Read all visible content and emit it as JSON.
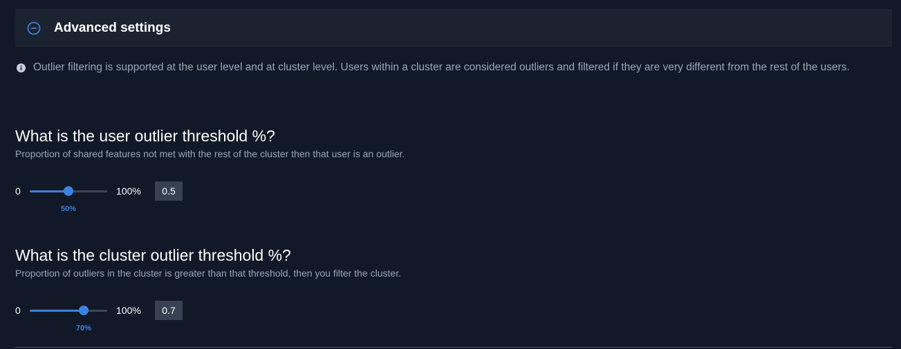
{
  "advanced_settings": {
    "title": "Advanced settings",
    "toggle_icon": "minus-circle-icon"
  },
  "info": {
    "icon": "info-icon",
    "text": "Outlier filtering is supported at the user level and at cluster level. Users within a cluster are considered outliers and filtered if they are very different from the rest of the users."
  },
  "user_threshold": {
    "title": "What is the user outlier threshold %?",
    "description": "Proportion of shared features not met with the rest of the cluster then that user is an outlier.",
    "min_label": "0",
    "max_label": "100%",
    "percent_label": "50%",
    "value": "0.5",
    "fraction": 0.5
  },
  "cluster_threshold": {
    "title": "What is the cluster outlier threshold %?",
    "description": "Proportion of outliers in the cluster is greater than that threshold, then you filter the cluster.",
    "min_label": "0",
    "max_label": "100%",
    "percent_label": "70%",
    "value": "0.7",
    "fraction": 0.7
  },
  "colors": {
    "background": "#111827",
    "header_background": "#1b2230",
    "accent": "#3b82e0",
    "muted_text": "#9aa6bd",
    "value_box": "#374151"
  }
}
